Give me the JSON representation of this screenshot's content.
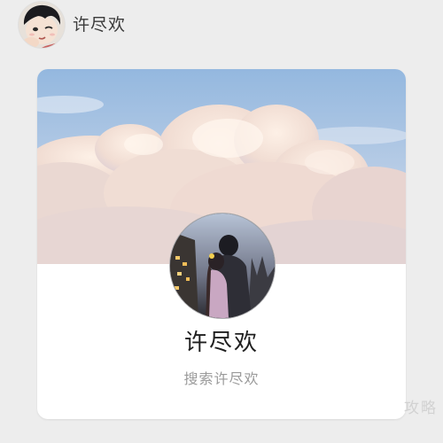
{
  "chat": {
    "sender_name": "许尽欢"
  },
  "card": {
    "profile_name": "许尽欢",
    "search_hint": "搜索许尽欢"
  },
  "watermark": {
    "text": "攻略"
  },
  "colors": {
    "page_background": "#ededed",
    "card_background": "#ffffff",
    "name_text": "#1f1f1f",
    "hint_text": "#9a9a9a",
    "sky": "#9ebfe2"
  },
  "icons": {
    "top_avatar": "cartoon-boy-avatar",
    "profile_avatar": "couple-photo-avatar"
  }
}
